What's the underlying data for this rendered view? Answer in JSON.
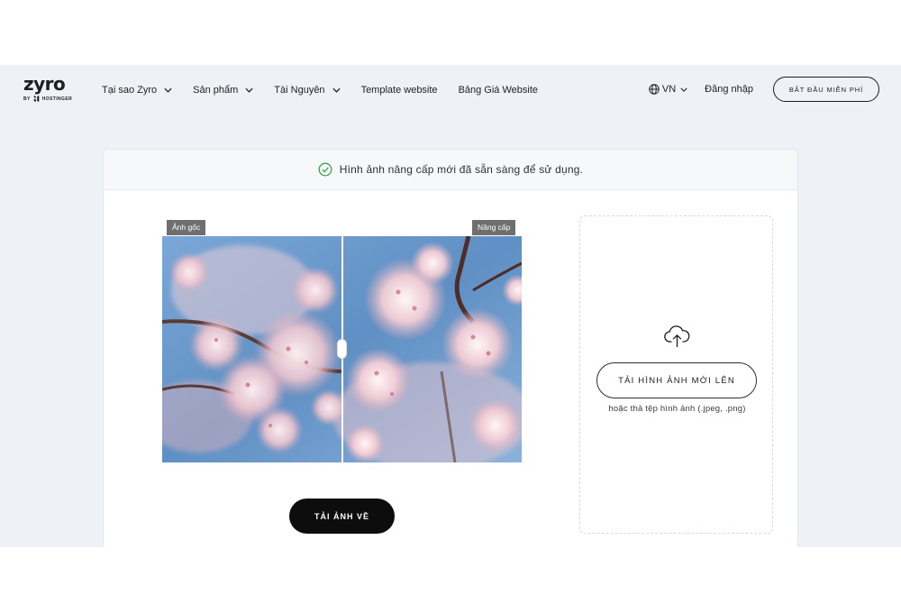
{
  "header": {
    "logo_word": "zyro",
    "logo_sub": "HOSTINGER",
    "logo_by": "BY",
    "nav": [
      {
        "label": "Tại sao Zyro",
        "dropdown": true
      },
      {
        "label": "Sản phẩm",
        "dropdown": true
      },
      {
        "label": "Tài Nguyên",
        "dropdown": true
      },
      {
        "label": "Template website",
        "dropdown": false
      },
      {
        "label": "Bảng Giá Website",
        "dropdown": false
      }
    ],
    "language": "VN",
    "login_label": "Đăng nhập",
    "cta_label": "BẮT ĐẦU MIỄN PHÍ"
  },
  "banner": {
    "message": "Hình ảnh nâng cấp mới đã sẵn sàng để sử dụng.",
    "icon": "check-circle-icon",
    "icon_color": "#3fa14b"
  },
  "comparison": {
    "left_label": "Ảnh gốc",
    "right_label": "Nâng cấp",
    "image": "cherry-blossom-photo",
    "slider_position": 0.5
  },
  "download_label": "TẢI ẢNH VỀ",
  "upload": {
    "button_label": "TẢI HÌNH ẢNH MỚI LÊN",
    "hint": "hoặc thả tệp hình ảnh (.jpeg, .png)",
    "icon": "cloud-upload-icon"
  },
  "colors": {
    "app_background": "#eef1f5",
    "primary_button": "#0d0d0d",
    "tag_background": "#6f6f6f",
    "sky": "#6f9fd0",
    "blossom": "#f2d3da"
  }
}
